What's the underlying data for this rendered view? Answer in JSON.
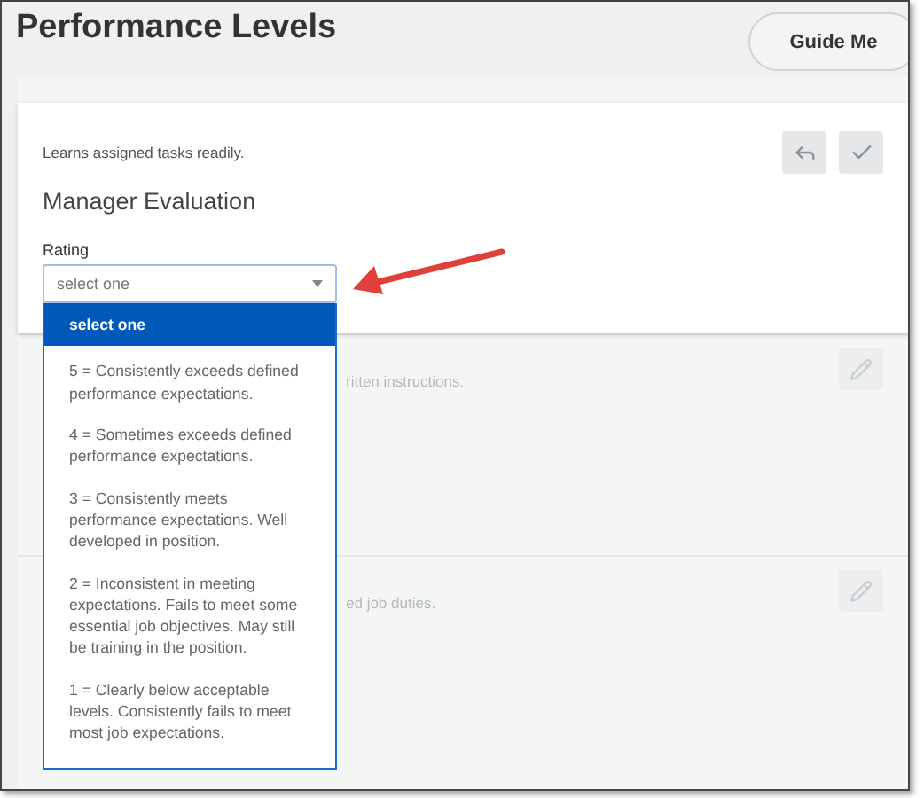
{
  "header": {
    "title": "Performance Levels",
    "guide_button": "Guide Me"
  },
  "active_card": {
    "competency": "Learns assigned tasks readily.",
    "section": "Manager Evaluation",
    "field_label": "Rating",
    "field_value": "select one",
    "expanded": true,
    "options": [
      {
        "label": "select one",
        "selected": true
      },
      {
        "label": "5 = Consistently exceeds defined performance expectations.",
        "selected": false
      },
      {
        "label": "4 = Sometimes exceeds defined performance expectations.",
        "selected": false
      },
      {
        "label": "3 = Consistently meets performance expectations. Well developed in position.",
        "selected": false
      },
      {
        "label": "2 = Inconsistent in meeting expectations. Fails to meet some essential job objectives. May still be training in the position.",
        "selected": false
      },
      {
        "label": "1 = Clearly below acceptable levels. Consistently fails to meet most job expectations.",
        "selected": false
      }
    ]
  },
  "other_cards": [
    {
      "competency": "ritten instructions."
    },
    {
      "competency": "ed job duties."
    }
  ]
}
